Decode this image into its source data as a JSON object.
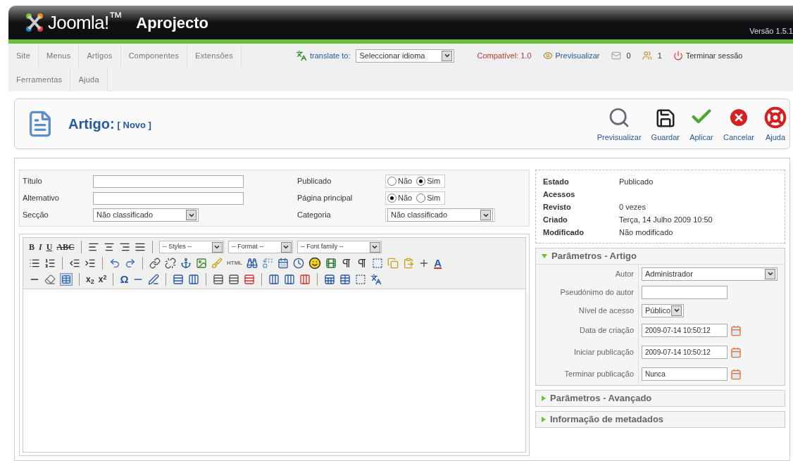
{
  "header": {
    "logo_text": "Joomla!$^{™}$",
    "site_name": "Aprojecto",
    "version": "Versão 1.5.1"
  },
  "menu": {
    "items": [
      "Site",
      "Menus",
      "Artigos",
      "Componentes",
      "Extensões",
      "Ferramentas",
      "Ajuda"
    ],
    "translate_label": "translate to:",
    "language_select": "Seleccionar idioma",
    "compat": "Compatível: 1.0",
    "preview": "Previsualizar",
    "messages": "0",
    "users": "1",
    "logout": "Terminar sessão"
  },
  "title": {
    "heading": "Artigo:",
    "note": "[ Novo ]"
  },
  "actions": [
    {
      "label": "Previsualizar",
      "kind": "preview"
    },
    {
      "label": "Guardar",
      "kind": "save"
    },
    {
      "label": "Aplicar",
      "kind": "apply"
    },
    {
      "label": "Cancelar",
      "kind": "cancel"
    },
    {
      "label": "Ajuda",
      "kind": "help"
    }
  ],
  "details": {
    "left": [
      {
        "label": "Título",
        "kind": "text"
      },
      {
        "label": "Alternativo",
        "kind": "text"
      },
      {
        "label": "Secção",
        "kind": "select",
        "value": "Não classificado"
      }
    ],
    "right": [
      {
        "label": "Publicado",
        "kind": "radio",
        "options": [
          {
            "label": "Não",
            "selected": false
          },
          {
            "label": "Sim",
            "selected": true
          }
        ]
      },
      {
        "label": "Página principal",
        "kind": "radio",
        "options": [
          {
            "label": "Não",
            "selected": true
          },
          {
            "label": "Sim",
            "selected": false
          }
        ]
      },
      {
        "label": "Categoria",
        "kind": "select",
        "value": "Não classificado"
      }
    ]
  },
  "editor": {
    "format_glyphs": [
      "B",
      "I",
      "U",
      "ABC"
    ],
    "selects": [
      "-- Styles --",
      "-- Format --",
      "-- Font family --"
    ],
    "html_glyph": "HTML",
    "sub_glyph": "x$_{2}$",
    "sup_glyph": "x$^{2}$",
    "omega_glyph": "Ω",
    "color_glyph": "A"
  },
  "info": [
    {
      "label": "Estado",
      "value": "Publicado"
    },
    {
      "label": "Acessos"
    },
    {
      "label": "Revisto",
      "value": "0 vezes"
    },
    {
      "label": "Criado",
      "value": "Terça, 14 Julho 2009 10:50"
    },
    {
      "label": "Modificado",
      "value": "Não modificado"
    }
  ],
  "params": [
    {
      "title": "Parâmetros - Artigo",
      "expanded": true,
      "fields": [
        {
          "label": "Autor",
          "kind": "select",
          "value": "Administrador",
          "wide": true
        },
        {
          "label": "Pseudónimo do autor",
          "kind": "text"
        },
        {
          "label": "Nível de acesso",
          "kind": "select",
          "value": "Público",
          "wide": false
        },
        {
          "label": "Data de criação",
          "kind": "date",
          "value": "2009-07-14 10:50:12"
        },
        {
          "label": "Iniciar publicação",
          "kind": "date",
          "value": "2009-07-14 10:50:12"
        },
        {
          "label": "Terminar publicação",
          "kind": "date",
          "value": "Nunca"
        }
      ]
    },
    {
      "title": "Parâmetros - Avançado",
      "expanded": false
    },
    {
      "title": "Informação de metadados",
      "expanded": false
    }
  ]
}
